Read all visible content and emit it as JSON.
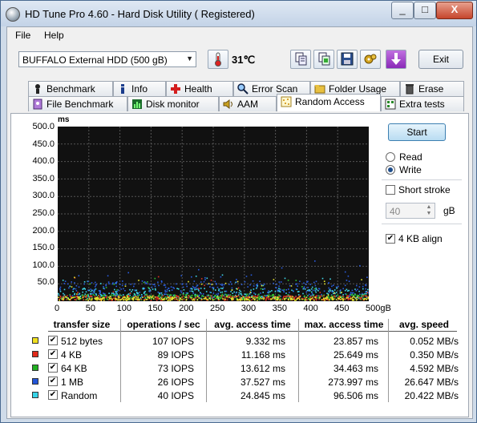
{
  "window": {
    "title": "HD Tune Pro 4.60 - Hard Disk Utility (  Registered)",
    "buttons": [
      "_",
      "□",
      "X"
    ]
  },
  "menu": {
    "items": [
      "File",
      "Help"
    ]
  },
  "toolbar": {
    "drive": "BUFFALO External HDD      (500 gB)",
    "temperature": "31℃",
    "exit_label": "Exit",
    "icons": [
      "thermometer-icon",
      "copy-info-icon",
      "copy-screen-icon",
      "save-icon",
      "options-icon",
      "download-icon"
    ]
  },
  "tabs": {
    "row1": [
      "Benchmark",
      "Info",
      "Health",
      "Error Scan",
      "Folder Usage",
      "Erase"
    ],
    "row2": [
      "File Benchmark",
      "Disk monitor",
      "AAM",
      "Random Access",
      "Extra tests"
    ],
    "active": "Random Access"
  },
  "controls": {
    "start": "Start",
    "read": "Read",
    "write": "Write",
    "short_stroke": "Short stroke",
    "stroke_value": "40",
    "stroke_unit": "gB",
    "align": "4 KB align",
    "read_checked": false,
    "write_checked": true,
    "short_stroke_checked": false,
    "align_checked": true
  },
  "chart_data": {
    "type": "scatter",
    "ylabel": "ms",
    "ylim": [
      0,
      500
    ],
    "xlim": [
      0,
      500
    ],
    "yticks": [
      "500.0",
      "450.0",
      "400.0",
      "350.0",
      "300.0",
      "250.0",
      "200.0",
      "150.0",
      "100.0",
      "50.0"
    ],
    "xticks": [
      "0",
      "50",
      "100",
      "150",
      "200",
      "250",
      "300",
      "350",
      "400",
      "450",
      "500gB"
    ],
    "grid": true,
    "series": [
      {
        "name": "512 bytes",
        "color": "#e8e830",
        "typical_ms": 9.3
      },
      {
        "name": "4 KB",
        "color": "#e03020",
        "typical_ms": 11.2
      },
      {
        "name": "64 KB",
        "color": "#30c030",
        "typical_ms": 13.6
      },
      {
        "name": "1 MB",
        "color": "#2a5de0",
        "typical_ms": 37.5
      },
      {
        "name": "Random",
        "color": "#40d8e8",
        "typical_ms": 24.8
      }
    ]
  },
  "results": {
    "headers": [
      "transfer size",
      "operations / sec",
      "avg. access time",
      "max. access time",
      "avg. speed"
    ],
    "rows": [
      {
        "size": "512 bytes",
        "color": "#f0e020",
        "ops": "107 IOPS",
        "avg": "9.332 ms",
        "max": "23.857 ms",
        "speed": "0.052 MB/s"
      },
      {
        "size": "4 KB",
        "color": "#e02a1a",
        "ops": "89 IOPS",
        "avg": "11.168 ms",
        "max": "25.649 ms",
        "speed": "0.350 MB/s"
      },
      {
        "size": "64 KB",
        "color": "#22b022",
        "ops": "73 IOPS",
        "avg": "13.612 ms",
        "max": "34.463 ms",
        "speed": "4.592 MB/s"
      },
      {
        "size": "1 MB",
        "color": "#2255d8",
        "ops": "26 IOPS",
        "avg": "37.527 ms",
        "max": "273.997 ms",
        "speed": "26.647 MB/s"
      },
      {
        "size": "Random",
        "color": "#38d4e8",
        "ops": "40 IOPS",
        "avg": "24.845 ms",
        "max": "96.506 ms",
        "speed": "20.422 MB/s"
      }
    ]
  }
}
